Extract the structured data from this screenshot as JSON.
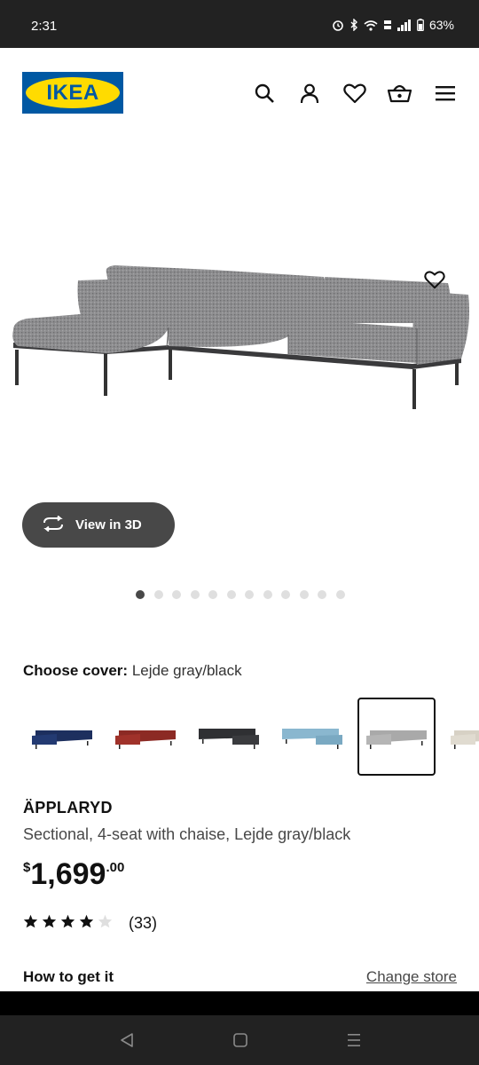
{
  "status_bar": {
    "time": "2:31",
    "battery": "63%",
    "icons": [
      "alarm-icon",
      "bluetooth-icon",
      "wifi-icon",
      "volte-icon",
      "signal-icon",
      "battery-icon"
    ]
  },
  "header": {
    "logo_text": "IKEA",
    "icons": [
      "search-icon",
      "account-icon",
      "heart-icon",
      "basket-icon",
      "menu-icon"
    ]
  },
  "gallery": {
    "view_3d_label": "View in 3D",
    "dot_count": 12,
    "active_dot": 0
  },
  "cover": {
    "label": "Choose cover:",
    "value": "Lejde gray/black",
    "swatch_colors": [
      "#1d2f5e",
      "#8c2a24",
      "#2f3033",
      "#8ab7cf",
      "#a9a9a9",
      "#d7d1c5"
    ],
    "selected_index": 4
  },
  "product": {
    "name": "ÄPPLARYD",
    "description": "Sectional, 4-seat with chaise, Lejde gray/black",
    "price_currency": "$",
    "price_integer": "1,699",
    "price_decimal": ".00",
    "rating_stars": 4,
    "rating_count": "(33)"
  },
  "delivery": {
    "heading": "How to get it",
    "change_store_label": "Change store"
  },
  "colors": {
    "ikea_blue": "#0058a3",
    "ikea_yellow": "#ffdb00",
    "button_dark": "#484848"
  }
}
